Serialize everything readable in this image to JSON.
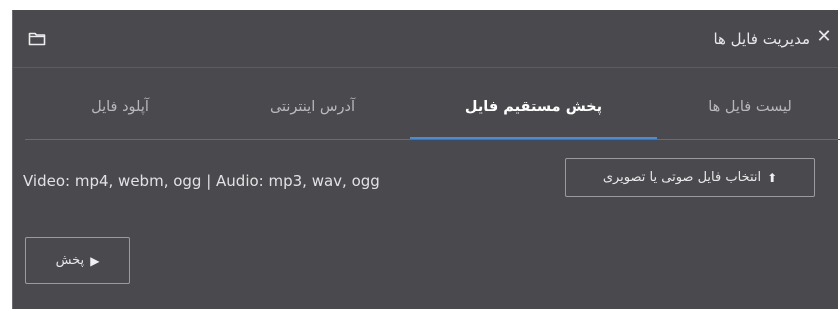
{
  "dialog": {
    "title": "مدیریت فایل ها",
    "close_glyph": "✕",
    "icons": {
      "close": "close-icon",
      "folder": "folder-icon"
    }
  },
  "tabs": [
    {
      "label": "لیست فایل ها",
      "active": false
    },
    {
      "label": "پخش مستقیم فایل",
      "active": true
    },
    {
      "label": "آدرس اینترنتی",
      "active": false
    },
    {
      "label": "آپلود فایل",
      "active": false
    }
  ],
  "player": {
    "formats_text": "Video: mp4, webm, ogg | Audio: mp3, wav, ogg",
    "select_button": {
      "label": "انتخاب فایل صوتی یا تصویری",
      "icon": "upload-icon",
      "glyph": "⬆"
    },
    "play_button": {
      "label": "پخش",
      "icon": "play-icon",
      "glyph": "▶"
    }
  },
  "colors": {
    "background": "#4a4a4e",
    "accent": "#3d8fe6",
    "text": "#e8e8ea"
  }
}
